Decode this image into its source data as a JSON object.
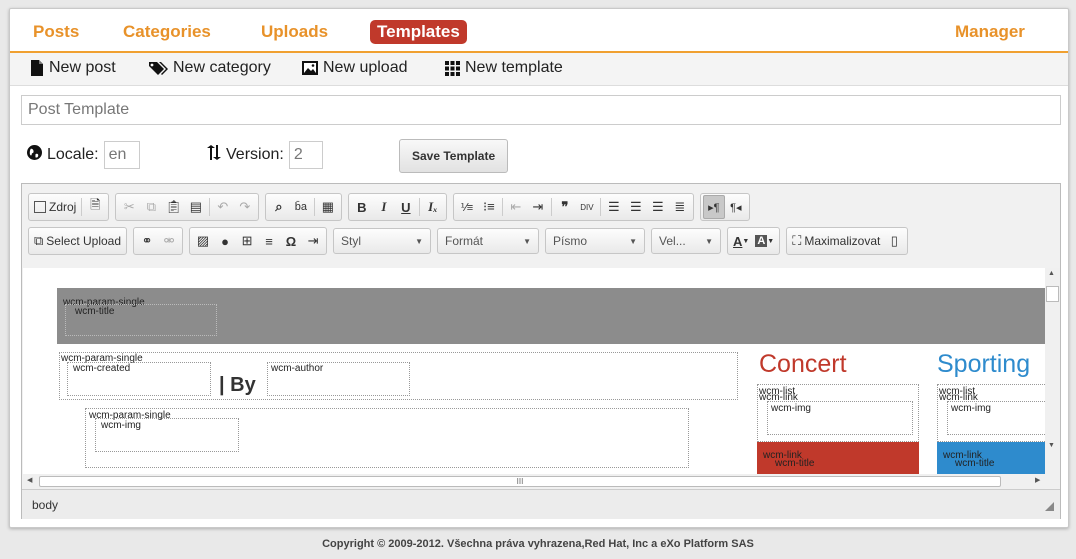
{
  "nav": {
    "tabs": [
      "Posts",
      "Categories",
      "Uploads",
      "Templates"
    ],
    "manager": "Manager"
  },
  "actions": {
    "new_post": "New post",
    "new_category": "New category",
    "new_upload": "New upload",
    "new_template": "New template"
  },
  "form": {
    "title_placeholder": "Post Template",
    "locale_label": "Locale:",
    "locale_value": "en",
    "version_label": "Version:",
    "version_value": "2",
    "save_label": "Save Template"
  },
  "toolbar": {
    "source": "Zdroj",
    "select_upload": "Select Upload",
    "style": "Styl",
    "format": "Formát",
    "font": "Písmo",
    "size": "Vel...",
    "maximize": "Maximalizovat"
  },
  "content": {
    "param_single": "wcm-param-single",
    "title": "wcm-title",
    "created": "wcm-created",
    "by": "| By",
    "author": "wcm-author",
    "img": "wcm-img",
    "list": "wcm-list",
    "link": "wcm-link",
    "concert": "Concert",
    "sporting": "Sporting",
    "concert_color": "#c0392b",
    "sporting_color": "#2e8bcd"
  },
  "statusbar": {
    "path": "body",
    "scroll_mark": "III"
  },
  "footer": "Copyright © 2009-2012. Všechna práva vyhrazena,Red Hat, Inc a eXo Platform SAS"
}
